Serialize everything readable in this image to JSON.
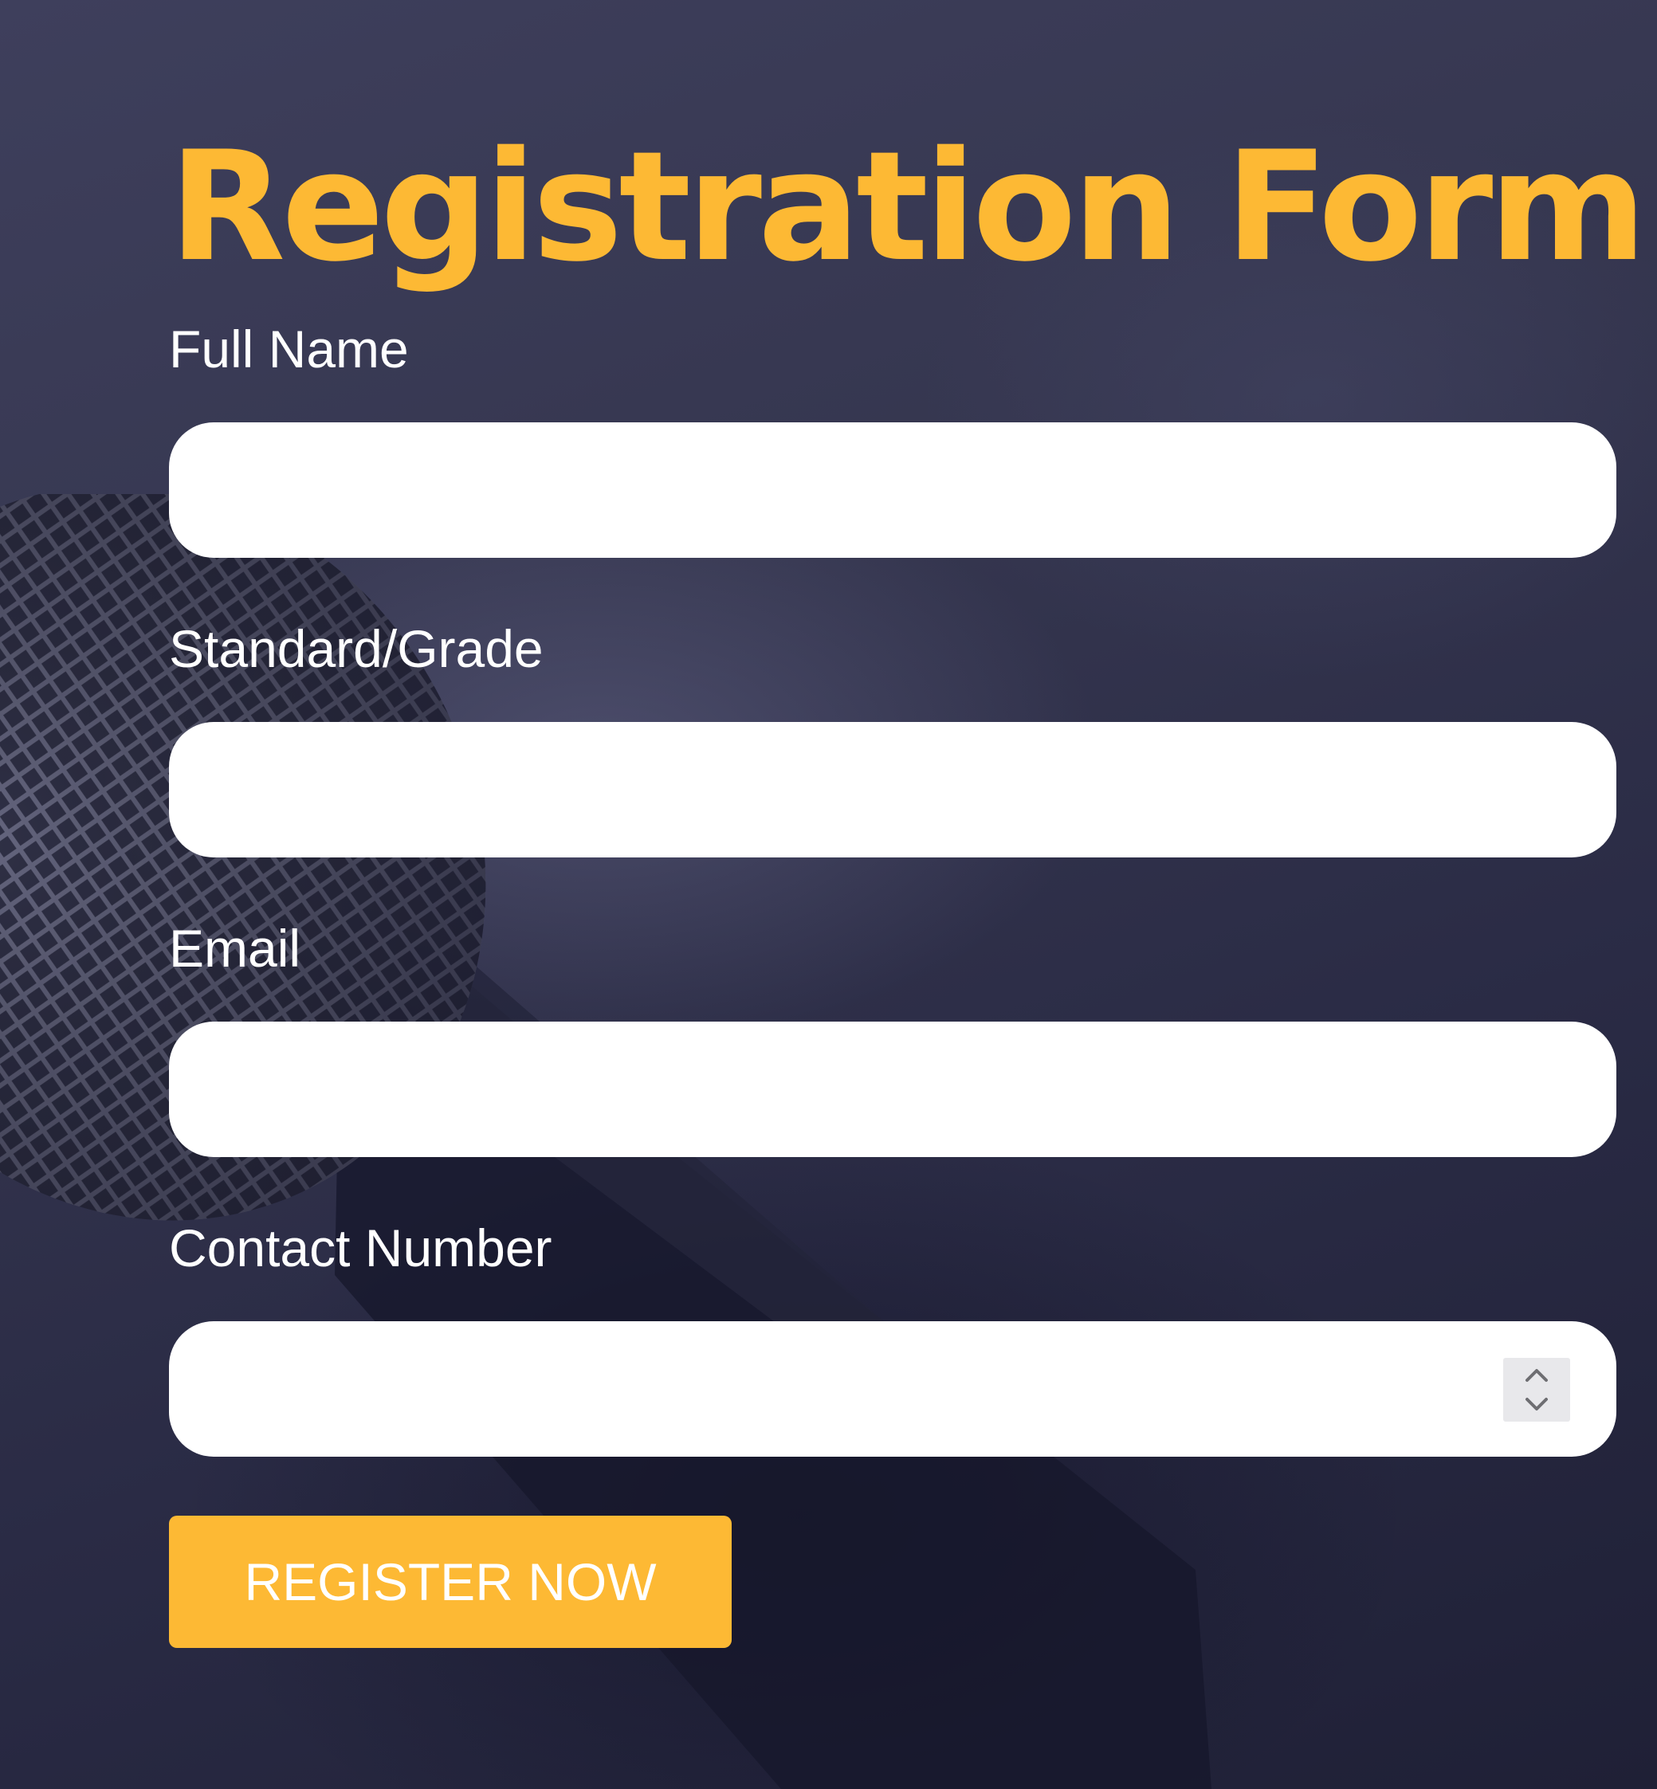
{
  "form": {
    "title": "Registration Form",
    "fields": [
      {
        "label": "Full Name",
        "value": "",
        "type": "text"
      },
      {
        "label": "Standard/Grade",
        "value": "",
        "type": "text"
      },
      {
        "label": "Email",
        "value": "",
        "type": "email"
      },
      {
        "label": "Contact Number",
        "value": "",
        "type": "number"
      }
    ],
    "submit_label": "REGISTER NOW"
  },
  "icons": {
    "spinner_up": "chevron-up-icon",
    "spinner_down": "chevron-down-icon"
  },
  "colors": {
    "accent": "#fdb934",
    "background": "#2c2d45",
    "field_bg": "#ffffff",
    "label_text": "#ffffff"
  }
}
